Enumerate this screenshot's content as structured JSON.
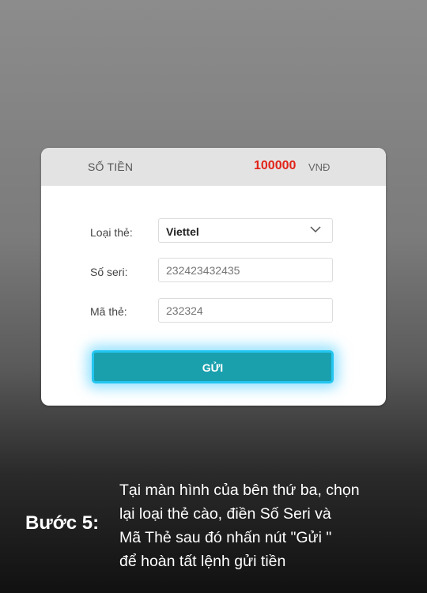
{
  "card": {
    "amount_label": "SỐ TIỀN",
    "amount_value": "100000",
    "amount_unit": "VNĐ",
    "card_type": {
      "label": "Loại thẻ:",
      "selected": "Viettel"
    },
    "serial": {
      "label": "Số seri:",
      "placeholder": "232423432435"
    },
    "pin": {
      "label": "Mã thẻ:",
      "placeholder": "232324"
    },
    "submit_label": "GỬI"
  },
  "caption": {
    "step": "Bước 5:",
    "lines": [
      "Tại màn hình của bên thứ ba, chọn",
      "lại loại thẻ cào, điền Số Seri và",
      "Mã Thẻ sau đó nhấn nút \"Gửi \"",
      "để hoàn tất lệnh gửi tiền"
    ]
  },
  "colors": {
    "amount": "#e2231a",
    "button": "#1aa0ad",
    "button_border": "#22c6f0"
  },
  "icons": {
    "dropdown": "chevron-down-icon"
  }
}
